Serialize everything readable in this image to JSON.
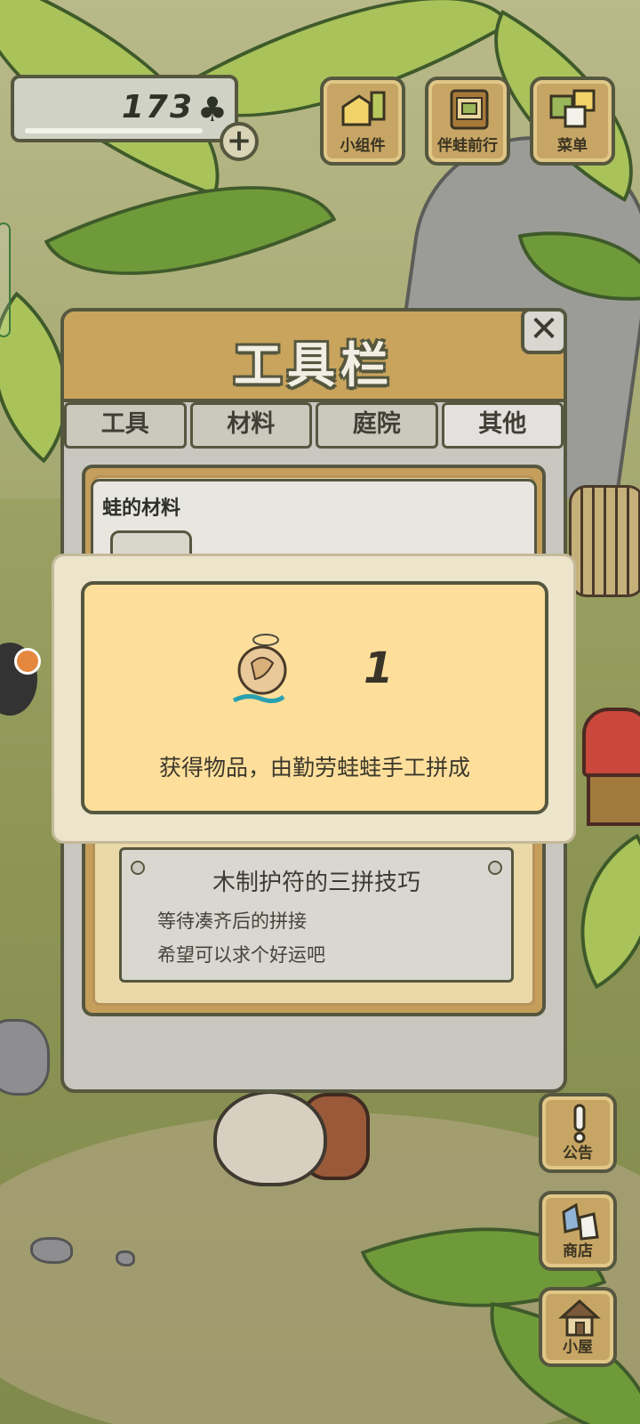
{
  "header": {
    "clover_count": "173",
    "add_label": "+"
  },
  "top_buttons": [
    {
      "label": "小组件",
      "icon": "widget-icon"
    },
    {
      "label": "伴蛙前行",
      "icon": "frog-journey-icon"
    },
    {
      "label": "菜单",
      "icon": "menu-icon"
    }
  ],
  "side_buttons": [
    {
      "label": "公告",
      "icon": "notice-icon"
    },
    {
      "label": "商店",
      "icon": "shop-icon"
    },
    {
      "label": "小屋",
      "icon": "house-icon"
    }
  ],
  "toolbar": {
    "title": "工具栏",
    "close_label": "✕",
    "tabs": [
      {
        "label": "工具",
        "active": false
      },
      {
        "label": "材料",
        "active": false
      },
      {
        "label": "庭院",
        "active": false
      },
      {
        "label": "其他",
        "active": true
      }
    ],
    "section_title": "蛙的材料",
    "note": {
      "title": "木制护符的三拼技巧",
      "lines": [
        "等待凑齐后的拼接",
        "希望可以求个好运吧"
      ]
    }
  },
  "popup": {
    "item_icon": "wooden-charm-icon",
    "count": "1",
    "message": "获得物品，由勤劳蛙蛙手工拼成"
  },
  "colors": {
    "panel_header": "#c9a45d",
    "outline": "#55573f",
    "popup_fill": "#fddf9b",
    "button_wood": "#c7a665"
  }
}
